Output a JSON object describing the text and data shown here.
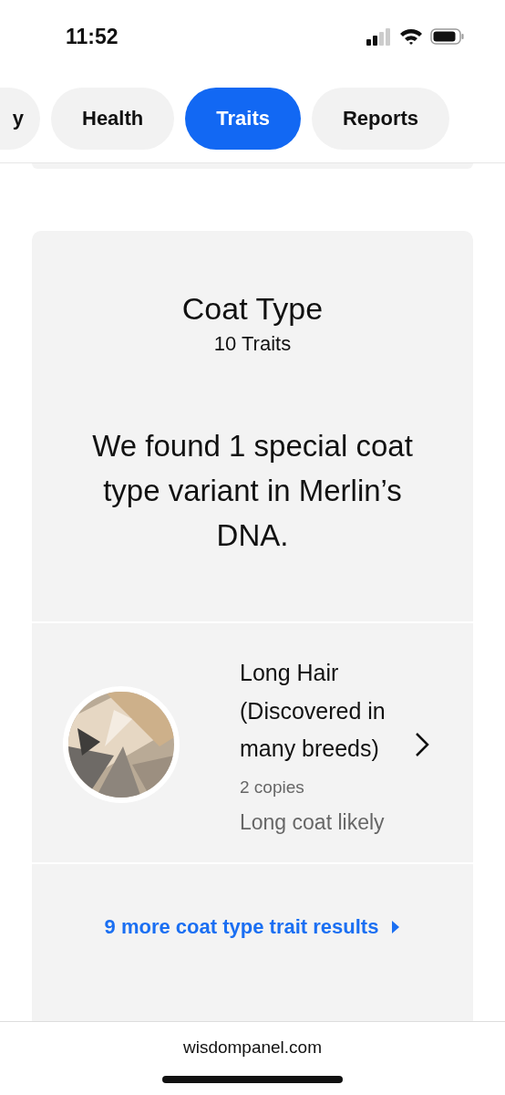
{
  "status_bar": {
    "time": "11:52"
  },
  "tabs": [
    {
      "label": "y",
      "selected": false
    },
    {
      "label": "Health",
      "selected": false
    },
    {
      "label": "Traits",
      "selected": true
    },
    {
      "label": "Reports",
      "selected": false
    }
  ],
  "card": {
    "title": "Coat Type",
    "subtitle": "10 Traits",
    "summary": "We found 1 special coat type variant in Merlin’s DNA.",
    "traits": [
      {
        "kind": "picture",
        "name": "Long Hair (Discovered in many breeds)",
        "copies": "2 copies",
        "result": "Long coat likely"
      }
    ],
    "more_link": "9 more coat type trait results"
  },
  "browser_bar": {
    "url": "wisdompanel.com"
  }
}
